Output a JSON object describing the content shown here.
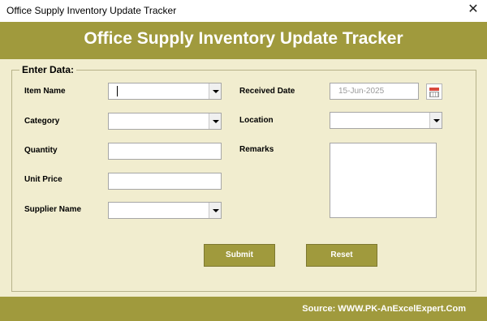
{
  "window": {
    "title": "Office Supply Inventory Update Tracker",
    "close_glyph": "✕"
  },
  "banner": {
    "heading": "Office Supply Inventory Update Tracker"
  },
  "form": {
    "legend": "Enter Data:",
    "item_name": {
      "label": "Item Name",
      "value": ""
    },
    "category": {
      "label": "Category",
      "value": ""
    },
    "quantity": {
      "label": "Quantity",
      "value": ""
    },
    "unit_price": {
      "label": "Unit Price",
      "value": ""
    },
    "supplier_name": {
      "label": "Supplier Name",
      "value": ""
    },
    "received_date": {
      "label": "Received Date",
      "value": "15-Jun-2025"
    },
    "location": {
      "label": "Location",
      "value": ""
    },
    "remarks": {
      "label": "Remarks",
      "value": ""
    }
  },
  "buttons": {
    "submit": "Submit",
    "reset": "Reset"
  },
  "footer": {
    "source": "Source: WWW.PK-AnExcelExpert.Com"
  },
  "colors": {
    "accent": "#a09a3d",
    "background": "#f1edcf"
  },
  "icons": {
    "close": "close-icon",
    "calendar": "calendar-icon",
    "dropdown": "chevron-down-icon"
  }
}
